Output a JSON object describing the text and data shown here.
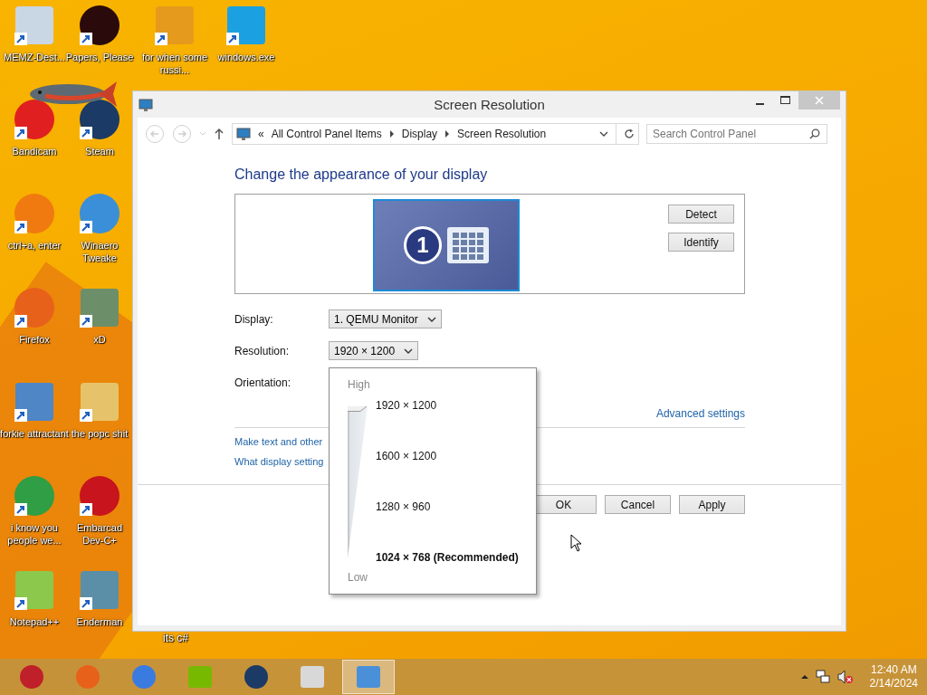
{
  "desktop": {
    "icons": [
      {
        "label": "MEMZ-Dest...",
        "kind": "square",
        "color": "#c9d6e4"
      },
      {
        "label": "Papers, Please",
        "kind": "circle",
        "color": "#2a0a0a"
      },
      {
        "label": "for when some russi...",
        "kind": "square",
        "color": "#e59a1e"
      },
      {
        "label": "windows.exe",
        "kind": "square",
        "color": "#1ba1e2"
      },
      {
        "label": "Bandicam",
        "kind": "circle",
        "color": "#e02020"
      },
      {
        "label": "Steam",
        "kind": "circle",
        "color": "#1b3a66"
      },
      {
        "label": "ctrl+a, enter",
        "kind": "circle",
        "color": "#f07a10"
      },
      {
        "label": "Winaero Tweake",
        "kind": "circle",
        "color": "#3a8fd8"
      },
      {
        "label": "Firefox",
        "kind": "circle",
        "color": "#e8611a"
      },
      {
        "label": "xD",
        "kind": "square",
        "color": "#6c8f6a"
      },
      {
        "label": "forkie attractant",
        "kind": "square",
        "color": "#4f86c6"
      },
      {
        "label": "the popc shit",
        "kind": "square",
        "color": "#e6c36a"
      },
      {
        "label": "i know you people we...",
        "kind": "circle",
        "color": "#2f9e44"
      },
      {
        "label": "Embarcad Dev-C+",
        "kind": "circle",
        "color": "#c8141c"
      },
      {
        "label": "Notepad++",
        "kind": "square",
        "color": "#8cc84b"
      },
      {
        "label": "Enderman",
        "kind": "square",
        "color": "#5b8fa8"
      }
    ],
    "stray_label": "its c#"
  },
  "window": {
    "title": "Screen Resolution",
    "breadcrumb": {
      "overflow": "«",
      "items": [
        "All Control Panel Items",
        "Display",
        "Screen Resolution"
      ]
    },
    "search": {
      "placeholder": "Search Control Panel"
    },
    "heading": "Change the appearance of your display",
    "monitor": {
      "number": "1"
    },
    "display_buttons": [
      "Detect",
      "Identify"
    ],
    "fields": [
      {
        "label": "Display:",
        "value": "1. QEMU Monitor"
      },
      {
        "label": "Resolution:",
        "value": "1920 × 1200"
      },
      {
        "label": "Orientation:"
      }
    ],
    "advanced_link": "Advanced settings",
    "links": [
      "Make text and other",
      "What display setting"
    ],
    "buttons": [
      "OK",
      "Cancel",
      "Apply"
    ],
    "resolution_popup": {
      "high": "High",
      "low": "Low",
      "level": 1,
      "options": [
        {
          "label": "1920 × 1200",
          "recommended": false
        },
        {
          "label": "1600 × 1200",
          "recommended": false
        },
        {
          "label": "1280 × 960",
          "recommended": false
        },
        {
          "label": "1024 × 768 (Recommended)",
          "recommended": true
        }
      ]
    }
  },
  "taskbar": {
    "apps": [
      {
        "kind": "circle",
        "color": "#c0202a",
        "active": false
      },
      {
        "kind": "circle",
        "color": "#e8611a",
        "active": false
      },
      {
        "kind": "circle",
        "color": "#3a7be0",
        "active": false
      },
      {
        "kind": "square",
        "color": "#76b900",
        "active": false
      },
      {
        "kind": "circle",
        "color": "#1b3a66",
        "active": false
      },
      {
        "kind": "square",
        "color": "#d8d8d8",
        "active": false
      },
      {
        "kind": "square",
        "color": "#4a90d9",
        "active": true
      }
    ],
    "time": "12:40 AM",
    "date": "2/14/2024"
  }
}
